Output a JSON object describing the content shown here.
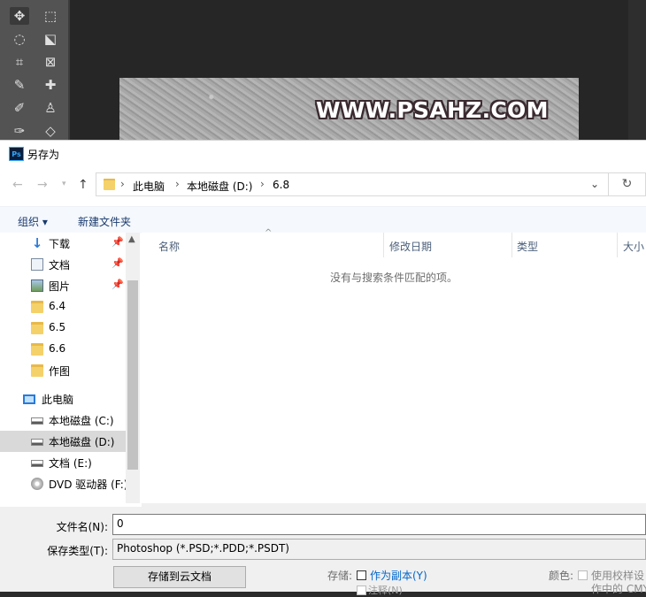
{
  "photoshop": {
    "watermark": "WWW.PSAHZ.COM",
    "tools": [
      "move-tool-icon",
      "marquee-tool-icon",
      "lasso-tool-icon",
      "object-select-tool-icon",
      "crop-tool-icon",
      "frame-tool-icon",
      "eyedropper-tool-icon",
      "healing-brush-tool-icon",
      "brush-tool-icon",
      "stamp-tool-icon",
      "history-brush-tool-icon",
      "eraser-tool-icon"
    ]
  },
  "dialog": {
    "icon_label": "Ps",
    "title": "另存为",
    "address": {
      "crumbs": [
        "此电脑",
        "本地磁盘 (D:)",
        "6.8"
      ]
    },
    "commands": {
      "organize": "组织 ▾",
      "new_folder": "新建文件夹"
    },
    "nav_items": [
      {
        "label": "下载",
        "icon": "download-icon",
        "pinned": true
      },
      {
        "label": "文档",
        "icon": "documents-icon",
        "pinned": true
      },
      {
        "label": "图片",
        "icon": "pictures-icon",
        "pinned": true
      },
      {
        "label": "6.4",
        "icon": "folder-icon",
        "pinned": false
      },
      {
        "label": "6.5",
        "icon": "folder-icon",
        "pinned": false
      },
      {
        "label": "6.6",
        "icon": "folder-icon",
        "pinned": false
      },
      {
        "label": "作图",
        "icon": "folder-icon",
        "pinned": false
      },
      {
        "label": "此电脑",
        "icon": "computer-icon",
        "pinned": false
      },
      {
        "label": "本地磁盘 (C:)",
        "icon": "drive-icon",
        "pinned": false
      },
      {
        "label": "本地磁盘 (D:)",
        "icon": "drive-icon",
        "pinned": false,
        "selected": true
      },
      {
        "label": "文档 (E:)",
        "icon": "drive-icon",
        "pinned": false
      },
      {
        "label": "DVD 驱动器 (F:)",
        "icon": "dvd-drive-icon",
        "pinned": false
      }
    ],
    "columns": [
      "名称",
      "修改日期",
      "类型",
      "大小"
    ],
    "empty_message": "没有与搜索条件匹配的项。",
    "filename_label": "文件名(N):",
    "filename_value": "0",
    "filetype_label": "保存类型(T):",
    "filetype_value": "Photoshop (*.PSD;*.PDD;*.PSDT)",
    "cloud_button": "存储到云文档",
    "save_label": "存储:",
    "as_copy": "作为副本(Y)",
    "color_label": "颜色:",
    "proof_setup_line1": "使用校样设",
    "proof_setup_line2": "作中的 CMY",
    "cut_off_text": "注释(N)"
  }
}
